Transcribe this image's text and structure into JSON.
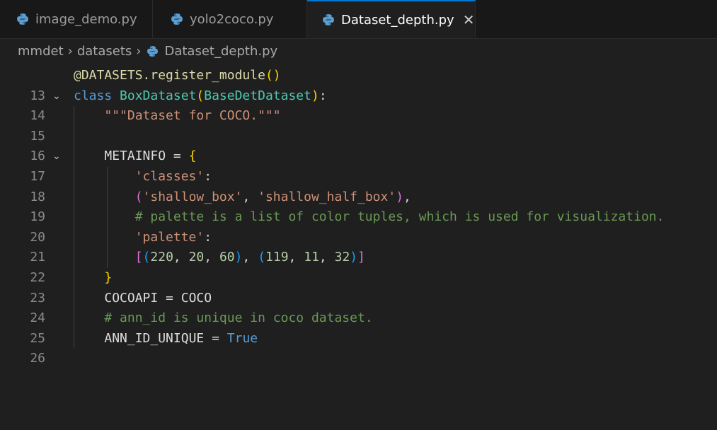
{
  "tabs": [
    {
      "label": "image_demo.py",
      "active": false
    },
    {
      "label": "yolo2coco.py",
      "active": false
    },
    {
      "label": "Dataset_depth.py",
      "active": true,
      "close": "✕"
    }
  ],
  "breadcrumb": {
    "items": [
      "mmdet",
      "datasets",
      "Dataset_depth.py"
    ],
    "separator": "›"
  },
  "editor": {
    "line_numbers": [
      "13",
      "14",
      "15",
      "16",
      "17",
      "18",
      "19",
      "20",
      "21",
      "22",
      "23",
      "24",
      "25",
      "26"
    ],
    "tokens": {
      "l13_deco": "@DATASETS.register_module",
      "l13_open": "(",
      "l13_close": ")",
      "l14_kw": "class",
      "l14_name": "BoxDataset",
      "l14_open": "(",
      "l14_base": "BaseDetDataset",
      "l14_close": ")",
      "l14_colon": ":",
      "l15_doc": "\"\"\"Dataset for COCO.\"\"\"",
      "l17_name": "METAINFO",
      "l17_eq": " = ",
      "l17_brace": "{",
      "l18_str": "'classes'",
      "l18_colon": ":",
      "l19_open": "(",
      "l19_s1": "'shallow_box'",
      "l19_comma": ", ",
      "l19_s2": "'shallow_half_box'",
      "l19_close": ")",
      "l19_end": ",",
      "l20_cmt": "# palette is a list of color tuples, which is used for visualization.",
      "l21_str": "'palette'",
      "l21_colon": ":",
      "l22_b1": "[",
      "l22_p1": "(",
      "l22_n1": "220",
      "l22_c1": ", ",
      "l22_n2": "20",
      "l22_c2": ", ",
      "l22_n3": "60",
      "l22_p1c": ")",
      "l22_c3": ", ",
      "l22_p2": "(",
      "l22_n4": "119",
      "l22_c4": ", ",
      "l22_n5": "11",
      "l22_c5": ", ",
      "l22_n6": "32",
      "l22_p2c": ")",
      "l22_b1c": "]",
      "l23_brace": "}",
      "l24_name": "COCOAPI",
      "l24_eq": " = ",
      "l24_val": "COCO",
      "l25_cmt": "# ann_id is unique in coco dataset.",
      "l26_name": "ANN_ID_UNIQUE",
      "l26_eq": " = ",
      "l26_val": "True"
    },
    "fold_icon": "⌄"
  },
  "colors": {
    "accent": "#0078d4",
    "python_blue": "#3776ab",
    "python_yellow": "#ffd43b"
  }
}
